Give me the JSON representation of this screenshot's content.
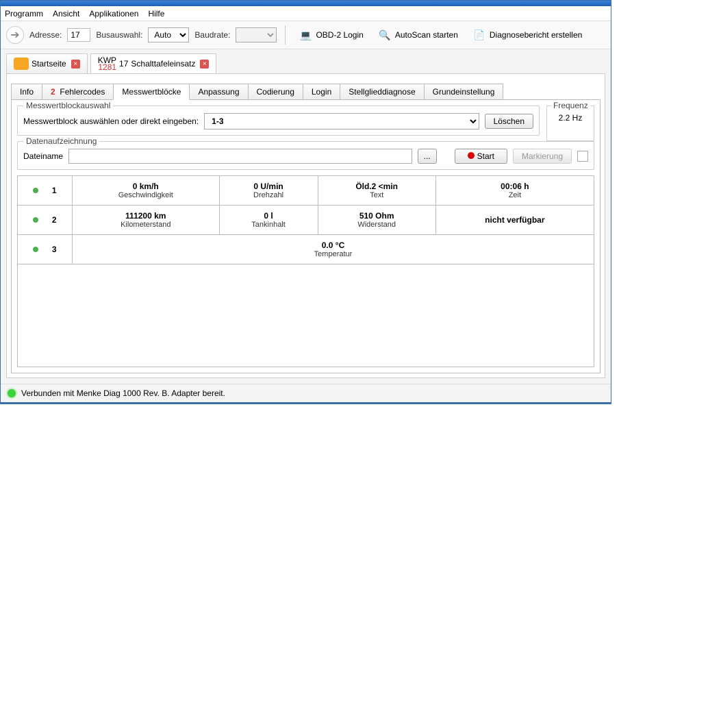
{
  "menu": {
    "program": "Programm",
    "view": "Ansicht",
    "apps": "Applikationen",
    "help": "Hilfe"
  },
  "toolbar": {
    "address_label": "Adresse:",
    "address_value": "17",
    "bus_label": "Busauswahl:",
    "bus_value": "Auto",
    "baud_label": "Baudrate:",
    "baud_value": "",
    "obd2": "OBD-2 Login",
    "autoscan": "AutoScan starten",
    "report": "Diagnosebericht erstellen"
  },
  "tabs": {
    "home": "Startseite",
    "kwp_top": "KWP",
    "kwp_num": "1281",
    "kwp_addr": "17",
    "kwp_name": "Schalttafeleinsatz"
  },
  "subtabs": {
    "info": "Info",
    "fc_count": "2",
    "fc_label": "Fehlercodes",
    "mwb": "Messwertblöcke",
    "anp": "Anpassung",
    "cod": "Codierung",
    "login": "Login",
    "stg": "Stellglieddiagnose",
    "gru": "Grundeinstellung"
  },
  "mwb": {
    "legend": "Messwertblockauswahl",
    "prompt": "Messwertblock auswählen oder direkt eingeben:",
    "selected": "1-3",
    "delete": "Löschen"
  },
  "freq": {
    "legend": "Frequenz",
    "value": "2.2  Hz"
  },
  "rec": {
    "legend": "Datenaufzeichnung",
    "filelabel": "Dateiname",
    "browse": "...",
    "start": "Start",
    "mark": "Markierung"
  },
  "rows": [
    {
      "idx": "1",
      "c1v": "0 km/h",
      "c1l": "Geschwindigkeit",
      "c2v": "0 U/min",
      "c2l": "Drehzahl",
      "c3v": "Öld.2 <min",
      "c3l": "Text",
      "c4v": "00:06 h",
      "c4l": "Zeit"
    },
    {
      "idx": "2",
      "c1v": "111200 km",
      "c1l": "Kilometerstand",
      "c2v": "0 l",
      "c2l": "Tankinhalt",
      "c3v": "510 Ohm",
      "c3l": "Widerstand",
      "c4v": "nicht verfügbar",
      "c4l": ""
    }
  ],
  "row3": {
    "idx": "3",
    "v": "0.0 °C",
    "l": "Temperatur"
  },
  "status": "Verbunden mit Menke Diag 1000 Rev. B. Adapter bereit."
}
